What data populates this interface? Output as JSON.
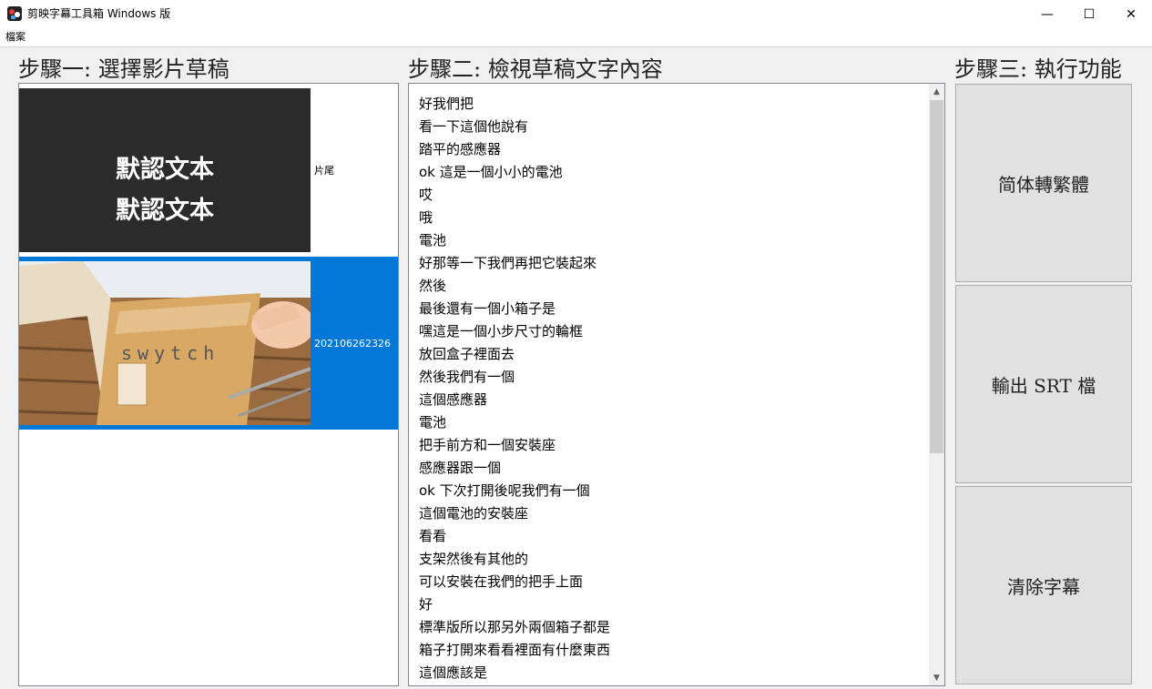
{
  "window": {
    "title": "剪映字幕工具箱 Windows 版",
    "controls": {
      "minimize": "—",
      "maximize": "☐",
      "close": "✕"
    }
  },
  "menu": {
    "items": [
      "檔案"
    ]
  },
  "steps": {
    "step1": "步驟一: 選擇影片草稿",
    "step2": "步驟二: 檢視草稿文字內容",
    "step3": "步驟三: 執行功能"
  },
  "drafts": [
    {
      "thumb_text": [
        "默認文本",
        "默認文本"
      ],
      "label": "片尾",
      "selected": false
    },
    {
      "thumb_caption": "swytch",
      "label": "202106262326",
      "selected": true
    }
  ],
  "subtitles": [
    "好我們把",
    "看一下這個他說有",
    "踏平的感應器",
    "ok 這是一個小小的電池",
    "哎",
    "哦",
    "電池",
    "好那等一下我們再把它裝起來",
    "然後",
    "最後還有一個小箱子是",
    "嘿這是一個小步尺寸的輪框",
    "放回盒子裡面去",
    "然後我們有一個",
    "這個感應器",
    "電池",
    "把手前方和一個安裝座",
    "感應器跟一個",
    "ok 下次打開後呢我們有一個",
    "這個電池的安裝座",
    "看看",
    "支架然後有其他的",
    "可以安裝在我們的把手上面",
    "好",
    "標準版所以那另外兩個箱子都是",
    "箱子打開來看看裡面有什麼東西",
    "這個應該是"
  ],
  "scroll": {
    "up": "▲",
    "down": "▼"
  },
  "actions": {
    "convert": "简体轉繁體",
    "export": "輸出 SRT 檔",
    "clear": "清除字幕"
  },
  "colors": {
    "selection": "#0078d7",
    "button_bg": "#e1e1e1"
  }
}
